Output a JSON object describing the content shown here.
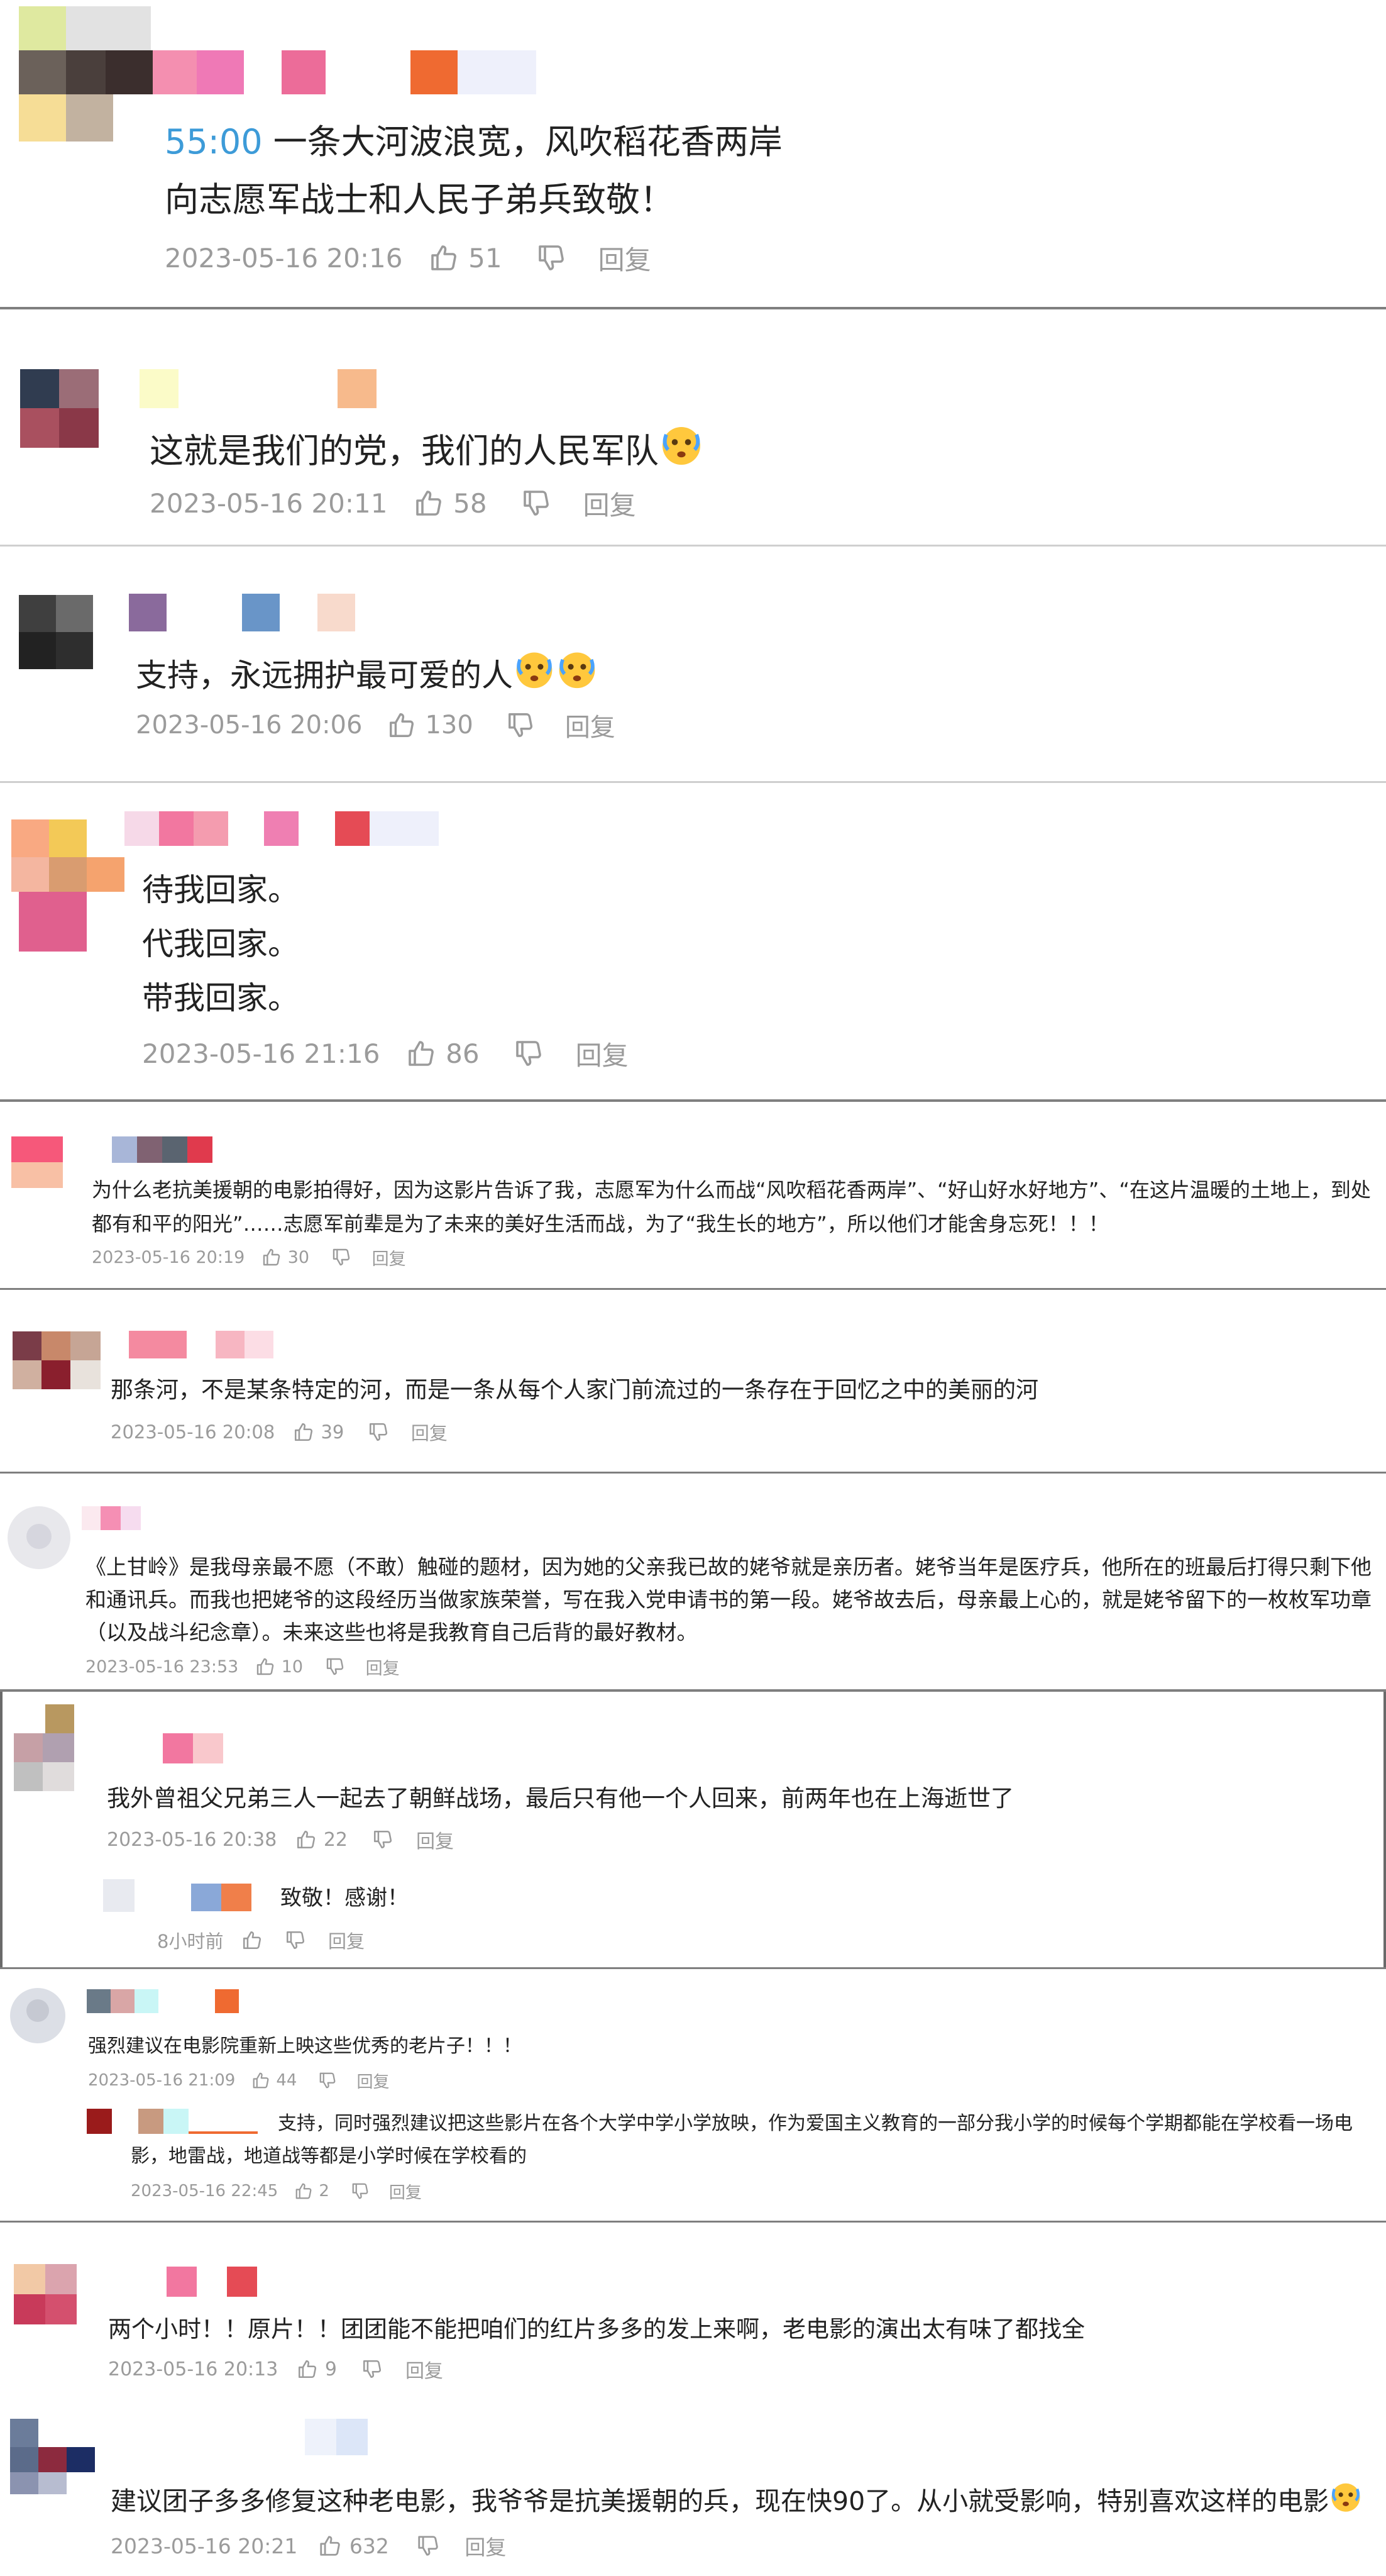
{
  "colors": {
    "meta_text": "#9b9b9b",
    "body_text": "#222222",
    "timestamp_link": "#3d9bd8",
    "separator": "#7f7f7f"
  },
  "icons": {
    "like": "thumbs-up-icon",
    "dislike": "thumbs-down-icon",
    "emoji": "crying-face-emoji"
  },
  "comments": [
    {
      "timestamp_link": "55:00",
      "lines": [
        "一条大河波浪宽，风吹稻花香两岸",
        "向志愿军战士和人民子弟兵致敬！"
      ],
      "date": "2023-05-16 20:16",
      "likes": "51",
      "reply": "回复"
    },
    {
      "lines": [
        "这就是我们的党，我们的人民军队"
      ],
      "date": "2023-05-16 20:11",
      "likes": "58",
      "reply": "回复"
    },
    {
      "lines": [
        "支持，永远拥护最可爱的人"
      ],
      "date": "2023-05-16 20:06",
      "likes": "130",
      "reply": "回复"
    },
    {
      "lines": [
        "待我回家。",
        "代我回家。",
        "带我回家。"
      ],
      "date": "2023-05-16 21:16",
      "likes": "86",
      "reply": "回复"
    },
    {
      "text": "为什么老抗美援朝的电影拍得好，因为这影片告诉了我，志愿军为什么而战“风吹稻花香两岸”、“好山好水好地方”、“在这片温暖的土地上，到处都有和平的阳光”……志愿军前辈是为了未来的美好生活而战，为了“我生长的地方”，所以他们才能舍身忘死！！！",
      "date": "2023-05-16 20:19",
      "likes": "30",
      "reply": "回复"
    },
    {
      "text": "那条河，不是某条特定的河，而是一条从每个人家门前流过的一条存在于回忆之中的美丽的河",
      "date": "2023-05-16 20:08",
      "likes": "39",
      "reply": "回复"
    },
    {
      "text": "《上甘岭》是我母亲最不愿（不敢）触碰的题材，因为她的父亲我已故的姥爷就是亲历者。姥爷当年是医疗兵，他所在的班最后打得只剩下他和通讯兵。而我也把姥爷的这段经历当做家族荣誉，写在我入党申请书的第一段。姥爷故去后，母亲最上心的，就是姥爷留下的一枚枚军功章（以及战斗纪念章）。未来这些也将是我教育自己后背的最好教材。",
      "date": "2023-05-16 23:53",
      "likes": "10",
      "reply": "回复"
    },
    {
      "text": "我外曾祖父兄弟三人一起去了朝鲜战场，最后只有他一个人回来，前两年也在上海逝世了",
      "date": "2023-05-16 20:38",
      "likes": "22",
      "reply": "回复",
      "sub": {
        "text": "致敬！感谢！",
        "date": "8小时前",
        "reply": "回复"
      }
    },
    {
      "text": "强烈建议在电影院重新上映这些优秀的老片子！！！",
      "date": "2023-05-16 21:09",
      "likes": "44",
      "reply": "回复",
      "sub": {
        "text": "支持，同时强烈建议把这些影片在各个大学中学小学放映，作为爱国主义教育的一部分我小学的时候每个学期都能在学校看一场电影，地雷战，地道战等都是小学时候在学校看的",
        "date": "2023-05-16 22:45",
        "likes": "2",
        "reply": "回复"
      }
    },
    {
      "text": "两个小时！！原片！！团团能不能把咱们的红片多多的发上来啊，老电影的演出太有味了都找全",
      "date": "2023-05-16 20:13",
      "likes": "9",
      "reply": "回复"
    },
    {
      "text": "建议团子多多修复这种老电影，我爷爷是抗美援朝的兵，现在快90了。从小就受影响，特别喜欢这样的电影",
      "date": "2023-05-16 20:21",
      "likes": "632",
      "reply": "回复"
    }
  ]
}
